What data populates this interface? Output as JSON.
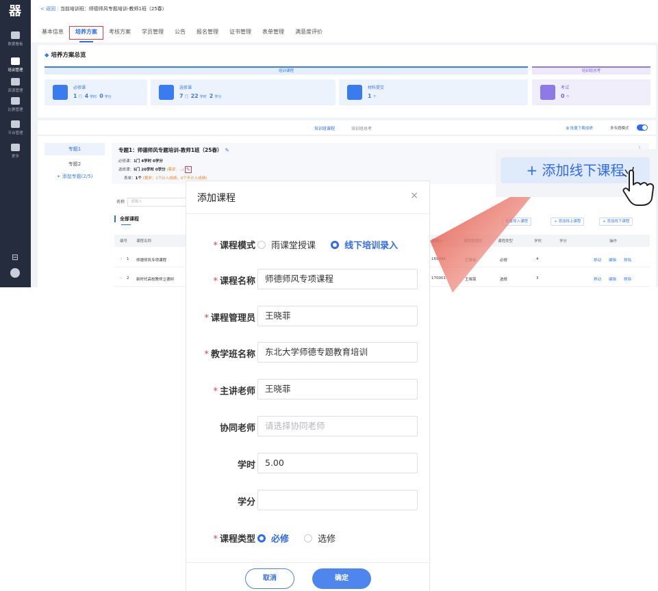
{
  "sidebar": {
    "logo": "器",
    "items": [
      {
        "label": "数据看板",
        "icon": "dashboard-icon"
      },
      {
        "label": "培训管理",
        "icon": "layers-icon"
      },
      {
        "label": "资源管理",
        "icon": "box-icon"
      },
      {
        "label": "比赛管理",
        "icon": "trophy-icon"
      },
      {
        "label": "平台管理",
        "icon": "monitor-icon"
      },
      {
        "label": "更多",
        "icon": "grid-icon"
      }
    ],
    "bottom_icons": [
      "collapse-icon",
      "avatar-icon"
    ]
  },
  "breadcrumb": {
    "back": "< 返回",
    "current": "当前培训班：师德师风专题培训-教师1班（25春）"
  },
  "tabs": [
    "基本信息",
    "培养方案",
    "考核方案",
    "学员管理",
    "公告",
    "报名管理",
    "证书管理",
    "表单管理",
    "满意度评价"
  ],
  "active_tab": "培养方案",
  "overview": {
    "title": "培养方案总览",
    "train_bar": "培训课程",
    "exam_bar": "培训班总考",
    "boxes": [
      {
        "title": "必修课",
        "n1": "1",
        "u1": "门",
        "n2": "4",
        "u2": "学时",
        "n3": "0",
        "u3": "学分"
      },
      {
        "title": "选修课",
        "n1": "7",
        "u1": "门",
        "n2": "22",
        "u2": "学时",
        "n3": "2",
        "u3": "学分"
      },
      {
        "title": "材料提交",
        "n1": "1",
        "u1": "个"
      },
      {
        "title": "考试",
        "n1": "0",
        "u1": "个"
      }
    ]
  },
  "plan": {
    "tab_courses": "培训班课程",
    "tab_exam": "培训班总考",
    "batch_download": "批量下载成绩",
    "multi_mode": "多专题模式",
    "topics": [
      "专题1",
      "专题2"
    ],
    "add_topic": "+ 添加专题(2/5)",
    "topic_title": "专题1：师德师风专题培训-教师1班（25春）",
    "required_line": {
      "label": "必修课：",
      "value": "1门  4学时  0学分"
    },
    "elective_line": {
      "label": "选修课：",
      "value": "5门  20学时  0学分",
      "req": "(要求：--)"
    },
    "form_line": {
      "label": "表单：",
      "value": "1个",
      "req": "(要求：1个计入成绩，0个不计入成绩)"
    },
    "name_label": "名称",
    "name_placeholder": "请输入",
    "all_courses": "全部课程",
    "btn_batch_import": "批量导入课程",
    "btn_add_online": "+ 添加线上课程",
    "btn_add_offline": "+ 添加线下课程",
    "columns": [
      "编号",
      "课程名称",
      "课程id",
      "课程管理员",
      "课程类型",
      "学时",
      "学分",
      "操作"
    ],
    "rows": [
      {
        "no": "1",
        "name": "师德师风专项课程",
        "id": "169996",
        "admin": "王晓菲",
        "type": "必修",
        "hours": "4",
        "ops": [
          "移动",
          "编辑",
          "移除"
        ]
      },
      {
        "no": "2",
        "name": "新时代高校教师立德树",
        "id": "170001",
        "admin": "王晓菲",
        "type": "选修",
        "hours": "3",
        "ops": [
          "移动",
          "编辑",
          "移除"
        ]
      }
    ]
  },
  "zoom_callout": {
    "label": "+ 添加线下课程"
  },
  "modal": {
    "title": "添加课程",
    "close": "×",
    "fields": {
      "mode_label": "课程模式",
      "mode_options": [
        "雨课堂授课",
        "线下培训录入"
      ],
      "mode_selected": "线下培训录入",
      "name_label": "课程名称",
      "name_value": "师德师风专项课程",
      "admin_label": "课程管理员",
      "admin_value": "王晓菲",
      "class_label": "教学班名称",
      "class_value": "东北大学师德专题教育培训",
      "teacher_label": "主讲老师",
      "teacher_value": "王晓菲",
      "co_label": "协同老师",
      "co_placeholder": "请选择协同老师",
      "hours_label": "学时",
      "hours_value": "5.00",
      "credit_label": "学分",
      "credit_value": "",
      "type_label": "课程类型",
      "type_options": [
        "必修",
        "选修"
      ],
      "type_selected": "必修"
    },
    "cancel": "取消",
    "ok": "确定"
  },
  "colors": {
    "accent": "#2f6bf0",
    "purple": "#8f79e8",
    "highlight": "#e23d3d",
    "nav": "#252c3d"
  }
}
